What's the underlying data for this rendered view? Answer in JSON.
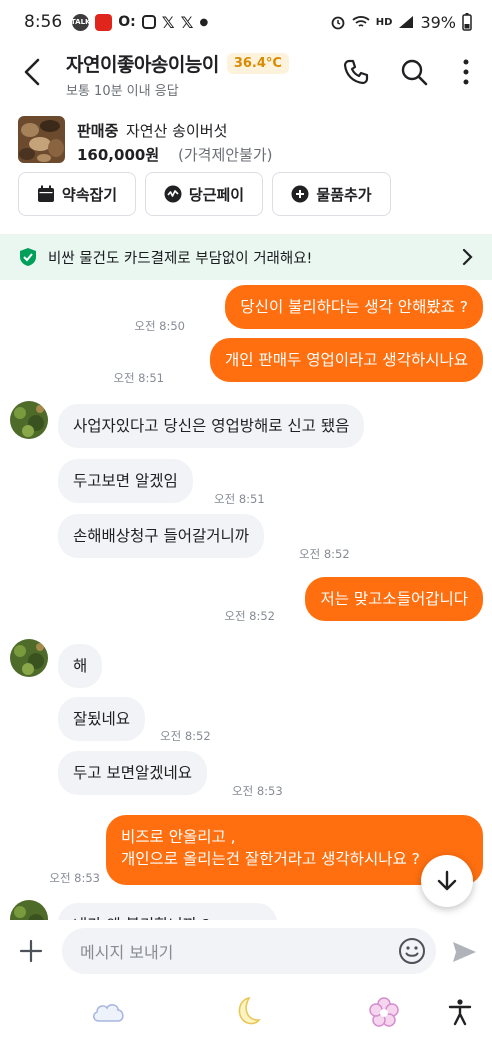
{
  "status_bar": {
    "time": "8:56",
    "battery": "39%",
    "network": "HD",
    "badges": [
      "talk-badge",
      "calendar-badge",
      "link-badge",
      "instagram-icon",
      "x-icon",
      "x-icon",
      "dot"
    ]
  },
  "header": {
    "title": "자연이좋아송이능이",
    "temperature": "36.4°C",
    "subtitle": "보통 10분 이내 응답",
    "icons": [
      "back-icon",
      "phone-icon",
      "search-icon",
      "more-icon"
    ]
  },
  "product": {
    "status": "판매중",
    "name": "자연산 송이버섯",
    "price": "160,000원",
    "note": "(가격제안불가)"
  },
  "actions": [
    {
      "label": "약속잡기",
      "icon": "calendar-icon"
    },
    {
      "label": "당근페이",
      "icon": "pay-icon"
    },
    {
      "label": "물품추가",
      "icon": "plus-circle-icon"
    }
  ],
  "banner": {
    "text": "비싼 물건도 카드결제로 부담없이 거래해요!",
    "icon": "shield-icon"
  },
  "messages": [
    {
      "side": "out",
      "text": "당신이 불리하다는 생각 안해봤죠 ?",
      "time": "오전 8:50"
    },
    {
      "side": "out",
      "text": "개인 판매두 영업이라고 생각하시나요",
      "time": "오전 8:51"
    },
    {
      "side": "in",
      "text": "사업자있다고 당신은 영업방해로 신고 됐음",
      "time": ""
    },
    {
      "side": "in",
      "text": "두고보면 알겠임",
      "time": "오전 8:51"
    },
    {
      "side": "in",
      "text": "손해배상청구 들어갈거니까",
      "time": "오전 8:52"
    },
    {
      "side": "out",
      "text": "저는 맞고소들어갑니다",
      "time": "오전 8:52"
    },
    {
      "side": "in",
      "text": "해",
      "time": ""
    },
    {
      "side": "in",
      "text": "잘됬네요",
      "time": "오전 8:52"
    },
    {
      "side": "in",
      "text": "두고 보면알겠네요",
      "time": "오전 8:53"
    },
    {
      "side": "out",
      "text_line1": "비즈로 안올리고 ,",
      "text_line2": "개인으로 올리는건 잘한거라고 생각하시나요 ?",
      "time": "오전 8:53"
    },
    {
      "side": "in",
      "text": "내가 왜 불리합니까 ?",
      "time": ""
    }
  ],
  "input": {
    "placeholder": "메시지 보내기"
  },
  "colors": {
    "accent": "#ff6f0f",
    "incoming_bubble": "#f2f3f6",
    "banner_bg": "#eaf7f1",
    "temperature": "#d98a00"
  }
}
